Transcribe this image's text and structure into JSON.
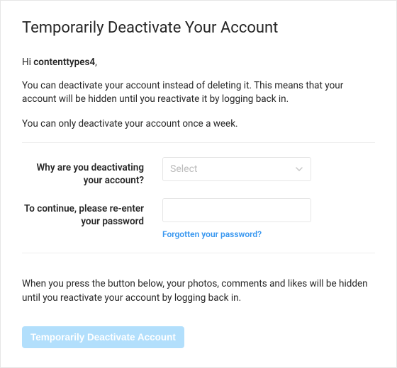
{
  "title": "Temporarily Deactivate Your Account",
  "greeting": {
    "prefix": "Hi ",
    "username": "contenttypes4",
    "suffix": ","
  },
  "info_line1": "You can deactivate your account instead of deleting it. This means that your account will be hidden until you reactivate it by logging back in.",
  "info_line2": "You can only deactivate your account once a week.",
  "form": {
    "reason_label": "Why are you deactivating your account?",
    "reason_placeholder": "Select",
    "password_label": "To continue, please re-enter your password",
    "password_value": "",
    "forgot_link": "Forgotten your password?"
  },
  "footer_text": "When you press the button below, your photos, comments and likes will be hidden until you reactivate your account by logging back in.",
  "button_label": "Temporarily Deactivate Account"
}
